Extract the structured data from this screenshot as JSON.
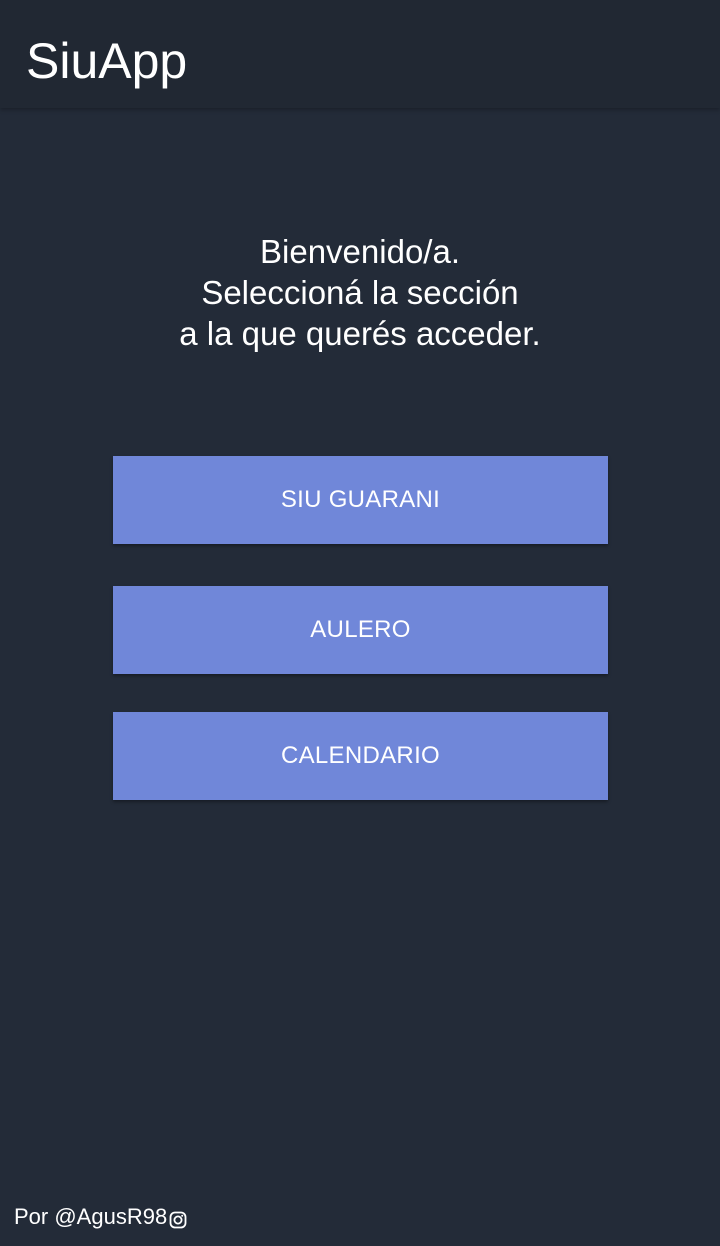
{
  "app_bar": {
    "title": "SiuApp"
  },
  "welcome": {
    "line1": "Bienvenido/a.",
    "line2": "Seleccioná la sección",
    "line3": "a la que querés acceder."
  },
  "buttons": [
    {
      "label": "SIU GUARANI"
    },
    {
      "label": "AULERO"
    },
    {
      "label": "CALENDARIO"
    }
  ],
  "footer": {
    "credit": "Por @AgusR98",
    "icon": "instagram-icon"
  },
  "colors": {
    "background": "#232b38",
    "app_bar": "#212833",
    "button": "#7087d9",
    "text": "#ffffff"
  }
}
